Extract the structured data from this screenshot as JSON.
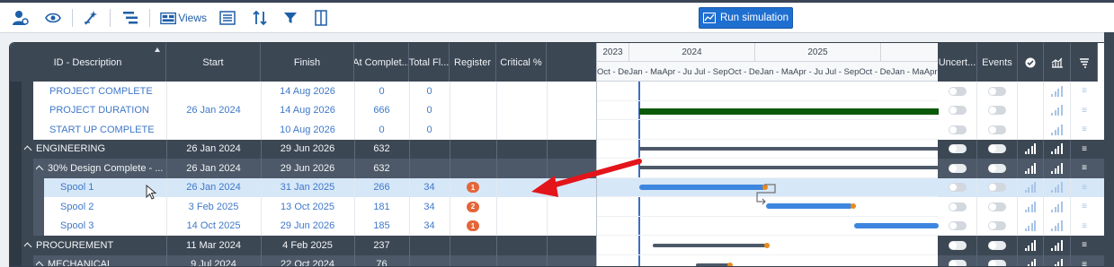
{
  "toolbar": {
    "views_label": "Views",
    "run_label": "Run simulation"
  },
  "columns": {
    "id": "ID - Description",
    "start": "Start",
    "finish": "Finish",
    "atcomp": "At Complet...",
    "totfl": "Total Fl...",
    "register": "Register",
    "critical": "Critical %",
    "uncert": "Uncert...",
    "events": "Events"
  },
  "gantt": {
    "years": [
      "2023",
      "2024",
      "2025"
    ],
    "quarters": "Oct - DeJan - MaApr - Ju Jul - SepOct - DeJan - MaApr - Ju Jul - SepOct - DeJan - MaApr - Ju"
  },
  "rows": [
    {
      "type": "task",
      "desc": "PROJECT COMPLETE",
      "start": "",
      "finish": "14 Aug 2026",
      "atc": "0",
      "tf": "0",
      "reg": ""
    },
    {
      "type": "task",
      "desc": "PROJECT DURATION",
      "start": "26 Jan 2024",
      "finish": "14 Aug 2026",
      "atc": "666",
      "tf": "0",
      "reg": ""
    },
    {
      "type": "task",
      "desc": "START UP COMPLETE",
      "start": "",
      "finish": "10 Aug 2026",
      "atc": "0",
      "tf": "0",
      "reg": ""
    },
    {
      "type": "grp1",
      "desc": "ENGINEERING",
      "start": "26 Jan 2024",
      "finish": "29 Jun 2026",
      "atc": "632",
      "tf": "",
      "reg": ""
    },
    {
      "type": "grp2",
      "desc": "30% Design Complete - ...",
      "start": "26 Jan 2024",
      "finish": "29 Jun 2026",
      "atc": "632",
      "tf": "",
      "reg": ""
    },
    {
      "type": "task2",
      "desc": "Spool 1",
      "start": "26 Jan 2024",
      "finish": "31 Jan 2025",
      "atc": "266",
      "tf": "34",
      "reg": "1"
    },
    {
      "type": "task2",
      "desc": "Spool 2",
      "start": "3 Feb 2025",
      "finish": "13 Oct 2025",
      "atc": "181",
      "tf": "34",
      "reg": "2"
    },
    {
      "type": "task2",
      "desc": "Spool 3",
      "start": "14 Oct 2025",
      "finish": "29 Jun 2026",
      "atc": "185",
      "tf": "34",
      "reg": "1"
    },
    {
      "type": "grp1",
      "desc": "PROCUREMENT",
      "start": "11 Mar 2024",
      "finish": "4 Feb 2025",
      "atc": "237",
      "tf": "",
      "reg": ""
    },
    {
      "type": "grp2",
      "desc": "MECHANICAL",
      "start": "9 Jul 2024",
      "finish": "22 Oct 2024",
      "atc": "76",
      "tf": "",
      "reg": ""
    }
  ]
}
